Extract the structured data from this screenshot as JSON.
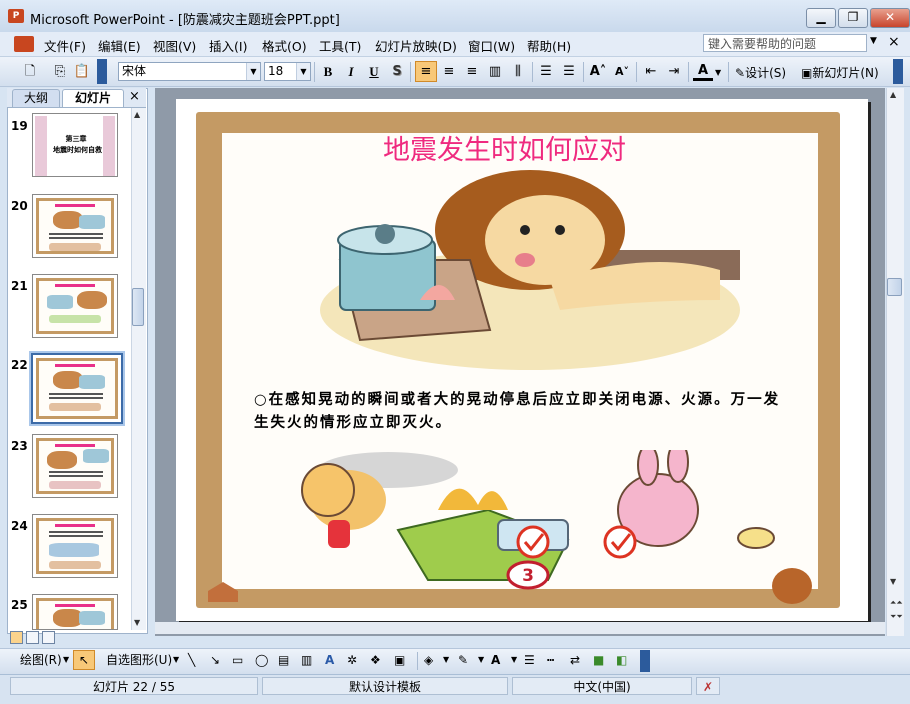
{
  "window": {
    "app_icon_text": "P",
    "title": "Microsoft PowerPoint - [防震减灾主题班会PPT.ppt]",
    "minimize": "▁",
    "maximize": "❐",
    "close": "✕"
  },
  "menu": {
    "items": [
      "文件(F)",
      "编辑(E)",
      "视图(V)",
      "插入(I)",
      "格式(O)",
      "工具(T)",
      "幻灯片放映(D)",
      "窗口(W)",
      "帮助(H)"
    ],
    "help_placeholder": "键入需要帮助的问题",
    "doc_close": "×"
  },
  "toolbar": {
    "font_name": "宋体",
    "font_size": "18",
    "bold": "B",
    "italic": "I",
    "underline": "U",
    "shadow": "S",
    "font_color": "A",
    "design_label": "设计(S)",
    "new_slide_label": "新幻灯片(N)"
  },
  "left_pane": {
    "tab_outline": "大纲",
    "tab_slides": "幻灯片",
    "close": "×",
    "slides": [
      {
        "number": "19",
        "title": "第三章\n地震时如何自救"
      },
      {
        "number": "20"
      },
      {
        "number": "21"
      },
      {
        "number": "22",
        "selected": true
      },
      {
        "number": "23"
      },
      {
        "number": "24"
      },
      {
        "number": "25"
      }
    ]
  },
  "slide": {
    "title": "地震发生时如何应对",
    "body": "○在感知晃动的瞬间或者大的晃动停息后应立即关闭电源、火源。万一发生失火的情形应立即灭火。",
    "number_badge": "3",
    "title_color": "#ef2a7f",
    "frame_color": "#c49a64"
  },
  "drawing_toolbar": {
    "draw_label": "绘图(R)",
    "autoshapes_label": "自选图形(U)"
  },
  "status": {
    "slide_position": "幻灯片 22 / 55",
    "template": "默认设计模板",
    "language": "中文(中国)"
  }
}
